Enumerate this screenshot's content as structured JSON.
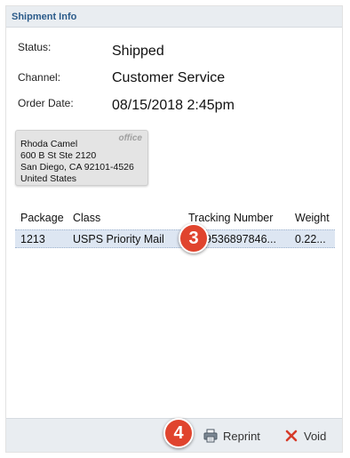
{
  "panel": {
    "title": "Shipment Info"
  },
  "fields": [
    {
      "label": "Status:",
      "value": "Shipped"
    },
    {
      "label": "Channel:",
      "value": "Customer Service"
    },
    {
      "label": "Order Date:",
      "value": "08/15/2018 2:45pm"
    }
  ],
  "address": {
    "tag": "office",
    "lines": [
      "Rhoda Camel",
      "600 B St Ste 2120",
      "San Diego, CA 92101-4526",
      "United States"
    ]
  },
  "packages_table": {
    "columns": [
      "Package",
      "Class",
      "Tracking Number",
      "Weight"
    ],
    "rows": [
      {
        "package": "1213",
        "class": "USPS Priority Mail",
        "tracking": "9536897846...",
        "weight": "0.22..."
      }
    ]
  },
  "callouts": {
    "first": "3",
    "second": "4"
  },
  "footer": {
    "reprint_label": "Reprint",
    "void_label": "Void"
  },
  "icons": {
    "reprint": "printer-icon",
    "void": "close-x-icon"
  },
  "colors": {
    "callout": "#e0442e",
    "header_text": "#2b5b8a",
    "row_highlight": "#dde6f2",
    "void_x": "#d63b2a"
  }
}
